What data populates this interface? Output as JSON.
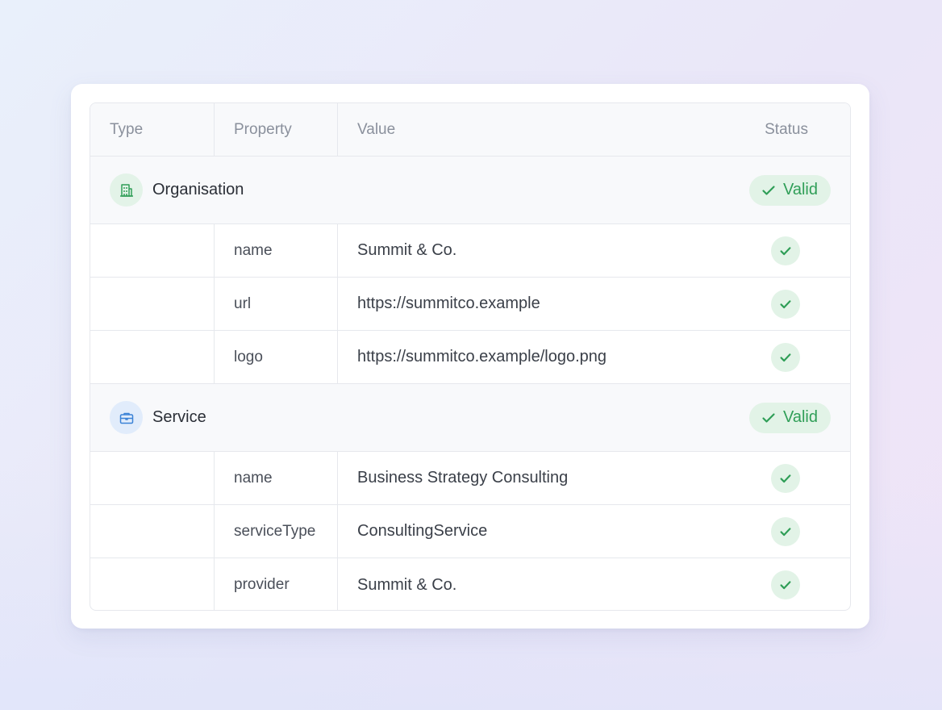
{
  "columns": {
    "type": "Type",
    "property": "Property",
    "value": "Value",
    "status": "Status"
  },
  "groups": [
    {
      "title": "Organisation",
      "icon": "building-icon",
      "status": "Valid",
      "rows": [
        {
          "property": "name",
          "value": "Summit & Co."
        },
        {
          "property": "url",
          "value": "https://summitco.example"
        },
        {
          "property": "logo",
          "value": "https://summitco.example/logo.png"
        }
      ]
    },
    {
      "title": "Service",
      "icon": "briefcase-icon",
      "status": "Valid",
      "rows": [
        {
          "property": "name",
          "value": "Business Strategy Consulting"
        },
        {
          "property": "serviceType",
          "value": "ConsultingService"
        },
        {
          "property": "provider",
          "value": "Summit & Co."
        }
      ]
    }
  ],
  "colors": {
    "valid_green": "#2f9e57",
    "valid_bg": "#e2f3e7",
    "service_blue": "#3b82d6",
    "service_bg": "#e1ecfb"
  }
}
